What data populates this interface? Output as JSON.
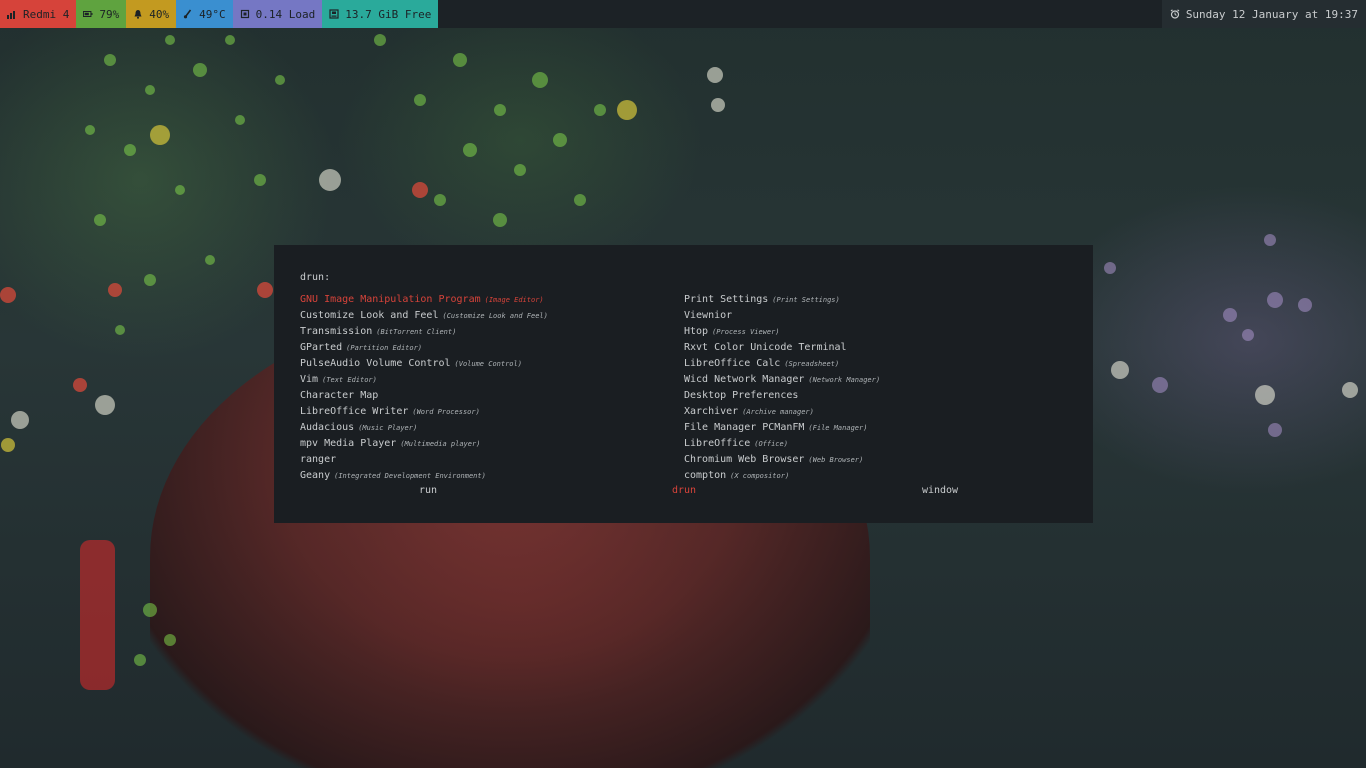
{
  "colors": {
    "segment_phone": "#d6433a",
    "segment_battery": "#5fa33f",
    "segment_volume": "#c39a20",
    "segment_temp": "#3a8fd0",
    "segment_load": "#7577c4",
    "segment_memory": "#2aaa9b",
    "accent_selected": "#d6433a"
  },
  "topbar": {
    "segments": [
      {
        "icon": "signal-bars-icon",
        "text": "Redmi 4"
      },
      {
        "icon": "battery-icon",
        "text": "79%"
      },
      {
        "icon": "bell-icon",
        "text": "40%"
      },
      {
        "icon": "thermometer-icon",
        "text": "49°C"
      },
      {
        "icon": "cpu-icon",
        "text": "0.14 Load"
      },
      {
        "icon": "memory-icon",
        "text": "13.7 GiB Free"
      }
    ],
    "clock": {
      "icon": "alarm-clock-icon",
      "text": "Sunday 12 January at 19:37"
    }
  },
  "launcher": {
    "prompt": "drun:",
    "items": [
      {
        "name": "GNU Image Manipulation Program",
        "generic": "(Image Editor)",
        "selected": true
      },
      {
        "name": "Print Settings",
        "generic": "(Print Settings)"
      },
      {
        "name": "Customize Look and Feel",
        "generic": "(Customize Look and Feel)"
      },
      {
        "name": "Viewnior",
        "generic": ""
      },
      {
        "name": "Transmission",
        "generic": "(BitTorrent Client)"
      },
      {
        "name": "Htop",
        "generic": "(Process Viewer)"
      },
      {
        "name": "GParted",
        "generic": "(Partition Editor)"
      },
      {
        "name": "Rxvt Color Unicode Terminal",
        "generic": ""
      },
      {
        "name": "PulseAudio Volume Control",
        "generic": "(Volume Control)"
      },
      {
        "name": "LibreOffice Calc",
        "generic": "(Spreadsheet)"
      },
      {
        "name": "Vim",
        "generic": "(Text Editor)"
      },
      {
        "name": "Wicd Network Manager",
        "generic": "(Network Manager)"
      },
      {
        "name": "Character Map",
        "generic": ""
      },
      {
        "name": "Desktop Preferences",
        "generic": ""
      },
      {
        "name": "LibreOffice Writer",
        "generic": "(Word Processor)"
      },
      {
        "name": "Xarchiver",
        "generic": "(Archive manager)"
      },
      {
        "name": "Audacious",
        "generic": "(Music Player)"
      },
      {
        "name": "File Manager PCManFM",
        "generic": "(File Manager)"
      },
      {
        "name": "mpv Media Player",
        "generic": "(Multimedia player)"
      },
      {
        "name": "LibreOffice",
        "generic": "(Office)"
      },
      {
        "name": "ranger",
        "generic": ""
      },
      {
        "name": "Chromium Web Browser",
        "generic": "(Web Browser)"
      },
      {
        "name": "Geany",
        "generic": "(Integrated Development Environment)"
      },
      {
        "name": "compton",
        "generic": "(X compositor)"
      }
    ],
    "modes": [
      {
        "label": "run",
        "active": false
      },
      {
        "label": "drun",
        "active": true
      },
      {
        "label": "window",
        "active": false
      }
    ]
  }
}
